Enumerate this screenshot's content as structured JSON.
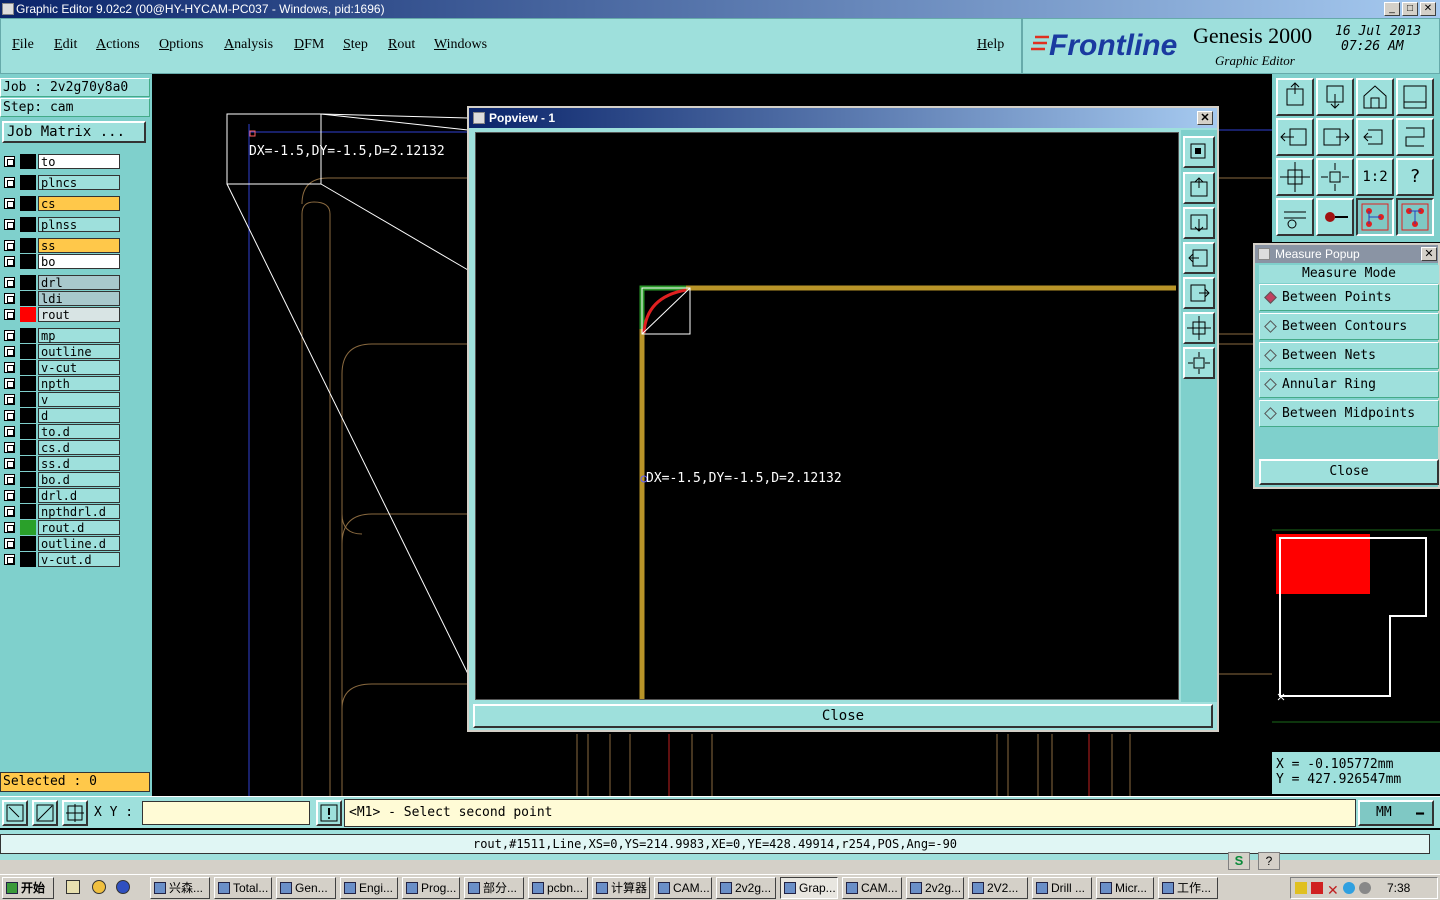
{
  "window": {
    "title": "Graphic Editor 9.02c2 (00@HY-HYCAM-PC037 - Windows, pid:1696)"
  },
  "menu": [
    "File",
    "Edit",
    "Actions",
    "Options",
    "Analysis",
    "DFM",
    "Step",
    "Rout",
    "Windows"
  ],
  "help": "Help",
  "brand": {
    "logo": "Frontline",
    "product": "Genesis 2000",
    "date": "16 Jul 2013",
    "time": "07:26 AM",
    "subtitle": "Graphic Editor"
  },
  "job": {
    "job_line": "Job : 2v2g70y8a0",
    "step_line": "Step: cam",
    "matrix_button": "Job Matrix ..."
  },
  "layers": [
    {
      "name": "to",
      "bg": "#ffffff"
    },
    {
      "name": "plncs",
      "bg": "#9ee0dc"
    },
    {
      "name": "cs",
      "bg": "#ffc84a"
    },
    {
      "name": "plnss",
      "bg": "#9ee0dc"
    },
    {
      "name": "ss",
      "bg": "#ffc84a"
    },
    {
      "name": "bo",
      "bg": "#ffffff"
    },
    {
      "name": "drl",
      "bg": "#a8c8cc"
    },
    {
      "name": "ldi",
      "bg": "#a8c8cc"
    },
    {
      "name": "rout",
      "bg": "#d8e4e4",
      "swatch": "#ff0000"
    },
    {
      "name": "mp",
      "bg": "#9ee0dc"
    },
    {
      "name": "outline",
      "bg": "#9ee0dc"
    },
    {
      "name": "v-cut",
      "bg": "#9ee0dc"
    },
    {
      "name": "npth",
      "bg": "#9ee0dc"
    },
    {
      "name": "v",
      "bg": "#9ee0dc"
    },
    {
      "name": "d",
      "bg": "#9ee0dc"
    },
    {
      "name": "to.d",
      "bg": "#9ee0dc"
    },
    {
      "name": "cs.d",
      "bg": "#9ee0dc"
    },
    {
      "name": "ss.d",
      "bg": "#9ee0dc"
    },
    {
      "name": "bo.d",
      "bg": "#9ee0dc"
    },
    {
      "name": "drl.d",
      "bg": "#9ee0dc"
    },
    {
      "name": "npthdrl.d",
      "bg": "#9ee0dc"
    },
    {
      "name": "rout.d",
      "bg": "#9ee0dc",
      "swatch": "#2aa02a"
    },
    {
      "name": "outline.d",
      "bg": "#9ee0dc"
    },
    {
      "name": "v-cut.d",
      "bg": "#9ee0dc"
    }
  ],
  "selected": "Selected : 0",
  "canvas": {
    "measure_label": "DX=-1.5,DY=-1.5,D=2.12132"
  },
  "popview": {
    "title": "Popview - 1",
    "measure_label": "DX=-1.5,DY=-1.5,D=2.12132",
    "close": "Close"
  },
  "toolgrid": {
    "zoom_label": "1:2",
    "help_label": "?"
  },
  "measure_popup": {
    "title": "Measure Popup",
    "mode_label": "Measure Mode",
    "options": [
      "Between Points",
      "Between Contours",
      "Between Nets",
      "Annular Ring",
      "Between Midpoints"
    ],
    "selected_index": 0,
    "close": "Close"
  },
  "coords": {
    "x": "X  =  -0.105772mm",
    "y": "Y  =  427.926547mm"
  },
  "cmd": {
    "xy_label": "X Y :",
    "prompt": "<M1> - Select second point",
    "units": "MM"
  },
  "status": "rout,#1511,Line,XS=0,YS=214.9983,XE=0,YE=428.49914,r254,POS,Ang=-90",
  "taskbar": {
    "start": "开始",
    "tasks": [
      "兴森...",
      "Total...",
      "Gen...",
      "Engi...",
      "Prog...",
      "部分...",
      "pcbn...",
      "计算器",
      "CAM...",
      "2v2g...",
      "Grap...",
      "CAM...",
      "2v2g...",
      "2V2...",
      "Drill ...",
      "Micr...",
      "工作..."
    ],
    "active_index": 10,
    "clock": "7:38"
  },
  "colors": {
    "panel": "#9ee0dc",
    "panel_dark": "#7fd0cc",
    "rout_line": "#c8a030",
    "highlight": "#ffc84a"
  }
}
